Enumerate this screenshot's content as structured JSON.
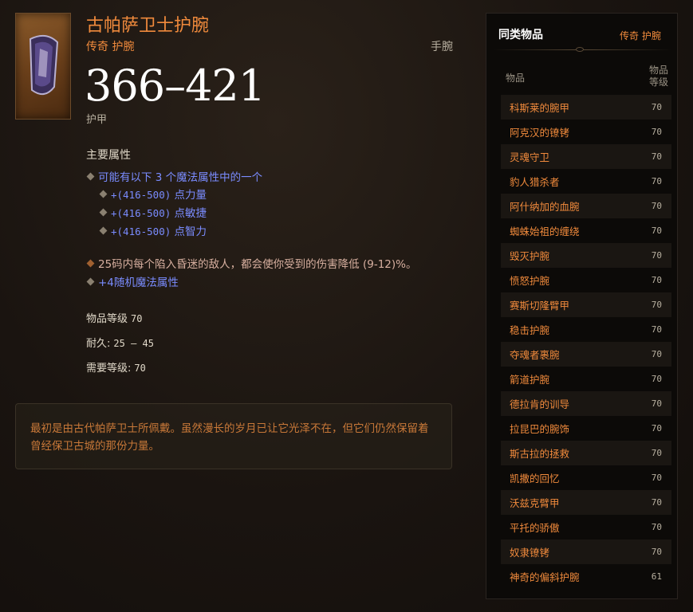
{
  "item": {
    "title": "古帕萨卫士护腕",
    "rarity_type": "传奇 护腕",
    "slot": "手腕",
    "armor_value": "366–421",
    "armor_label": "护甲"
  },
  "primary": {
    "heading": "主要属性",
    "choice_line": "可能有以下 3 个魔法属性中的一个",
    "options": [
      {
        "prefix": "+(416-500)",
        "stat": " 点力量"
      },
      {
        "prefix": "+(416-500)",
        "stat": " 点敏捷"
      },
      {
        "prefix": "+(416-500)",
        "stat": " 点智力"
      }
    ],
    "legendary_affix": "25码内每个陷入昏迷的敌人，都会使你受到的伤害降低 (9-12)%。",
    "random_line": "+4随机魔法属性"
  },
  "meta": {
    "item_level_label": "物品等级",
    "item_level_value": "70",
    "durability_label": "耐久:",
    "durability_value": "25 – 45",
    "req_level_label": "需要等级:",
    "req_level_value": "70"
  },
  "flavor": {
    "text": "最初是由古代帕萨卫士所佩戴。虽然漫长的岁月已让它光泽不在，但它们仍然保留着曾经保卫古城的那份力量。"
  },
  "sidebar": {
    "title": "同类物品",
    "subtitle": "传奇 护腕",
    "col_item": "物品",
    "col_level": "物品等级",
    "rows": [
      {
        "name": "科斯莱的腕甲",
        "level": "70"
      },
      {
        "name": "阿克汉的镣铐",
        "level": "70"
      },
      {
        "name": "灵魂守卫",
        "level": "70"
      },
      {
        "name": "豹人猎杀者",
        "level": "70"
      },
      {
        "name": "阿什纳加的血腕",
        "level": "70"
      },
      {
        "name": "蜘蛛始祖的缠绕",
        "level": "70"
      },
      {
        "name": "毁灭护腕",
        "level": "70"
      },
      {
        "name": "愤怒护腕",
        "level": "70"
      },
      {
        "name": "赛斯切隆臂甲",
        "level": "70"
      },
      {
        "name": "稳击护腕",
        "level": "70"
      },
      {
        "name": "夺魂者裹腕",
        "level": "70"
      },
      {
        "name": "箭道护腕",
        "level": "70"
      },
      {
        "name": "德拉肯的训导",
        "level": "70"
      },
      {
        "name": "拉昆巴的腕饰",
        "level": "70"
      },
      {
        "name": "斯古拉的拯救",
        "level": "70"
      },
      {
        "name": "凯撒的回忆",
        "level": "70"
      },
      {
        "name": "沃兹克臂甲",
        "level": "70"
      },
      {
        "name": "平托的骄傲",
        "level": "70"
      },
      {
        "name": "奴隶镣铐",
        "level": "70"
      },
      {
        "name": "神奇的偏斜护腕",
        "level": "61"
      }
    ]
  },
  "colors": {
    "legendary": "#f08a3c",
    "magic": "#7a8cff"
  }
}
